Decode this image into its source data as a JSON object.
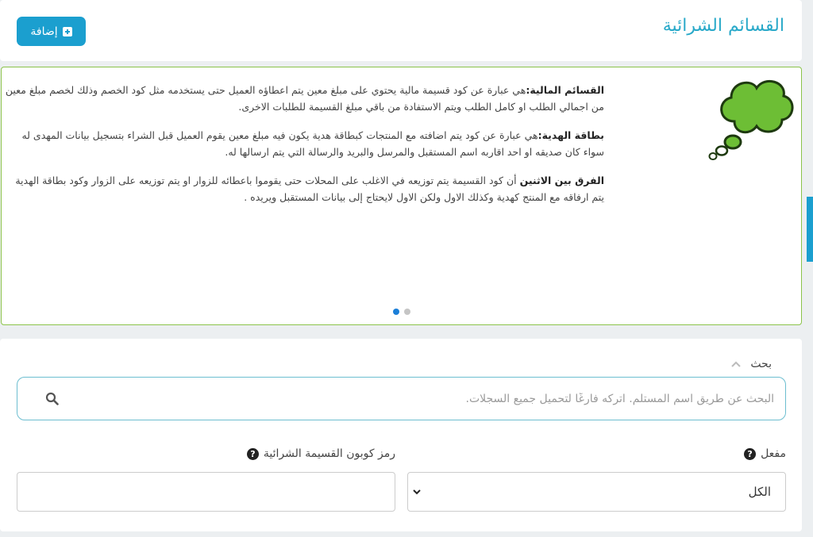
{
  "header": {
    "title": "القسائم الشرائية",
    "add_button_label": "إضافة"
  },
  "info": {
    "items": [
      {
        "term": "القسائم المالية:",
        "text": "هي عبارة عن كود قسيمة مالية يحتوي على مبلغ معين يتم اعطاؤه العميل حتى يستخدمه مثل كود الخصم وذلك لخصم مبلغ معين من اجمالي الطلب او كامل الطلب ويتم الاستفادة من باقي مبلغ القسيمة للطلبات الاخرى."
      },
      {
        "term": "بطاقة الهدية:",
        "text": "هي عبارة عن كود يتم اضافته مع المنتجات كبطاقة هدية يكون فيه مبلغ معين يقوم العميل قبل الشراء بتسجيل بيانات المهدى له سواء كان صديقه او احد اقاربه اسم المستقبل والمرسل والبريد والرسالة التي يتم ارسالها له."
      },
      {
        "term": "الفرق بين الاثنين",
        "text": " أن كود القسيمة يتم توزيعه في الاغلب على المحلات حتى يقوموا باعطائه للزوار او يتم توزيعه على الزوار وكود بطاقة الهدية يتم ارفاقه مع المنتج كهدية وكذلك الاول ولكن الاول لايحتاج إلى بيانات المستقبل ويريده ."
      }
    ]
  },
  "filters": {
    "search_toggle_label": "بحث",
    "search_placeholder": "البحث عن طريق اسم المستلم. اتركه فارغًا لتحميل جميع السجلات.",
    "active_label": "مفعل",
    "active_value": "الكل",
    "coupon_label": "رمز كوبون القسيمة الشرائية",
    "coupon_value": ""
  },
  "icons": {
    "add": "plus-square-icon",
    "thought": "thought-cloud-icon",
    "search": "search-icon",
    "collapse": "chevron-up-icon",
    "dropdown": "chevron-down-icon",
    "help": "question-circle-icon"
  },
  "colors": {
    "accent": "#1b9fcf",
    "title": "#29a9c9",
    "cloud_green": "#6dbe35",
    "card_border": "#8bc34a",
    "active_dot": "#1b7fd8"
  }
}
